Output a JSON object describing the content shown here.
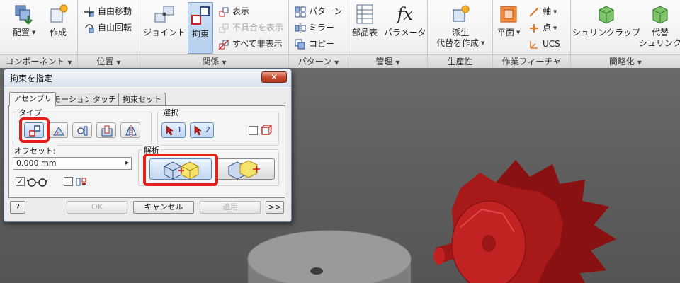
{
  "ribbon": {
    "component": {
      "title": "コンポーネント",
      "place_label": "配置",
      "create_label": "作成"
    },
    "position": {
      "title": "位置",
      "free_move_label": "自由移動",
      "free_rotate_label": "自由回転"
    },
    "relationships": {
      "title": "関係",
      "joint_label": "ジョイント",
      "constrain_label": "拘束",
      "show_label": "表示",
      "show_sick_label": "不具合を表示",
      "hide_all_label": "すべて非表示"
    },
    "pattern": {
      "title": "パターン",
      "pattern_label": "パターン",
      "mirror_label": "ミラー",
      "copy_label": "コピー"
    },
    "manage": {
      "title": "管理",
      "bom_label": "部品表",
      "parameters_label": "パラメータ",
      "fx_glyph": "fx"
    },
    "productivity": {
      "title": "生産性",
      "derive_label_1": "派生",
      "derive_label_2": "代替を作成"
    },
    "work_features": {
      "title": "作業フィーチャ",
      "plane_label": "平面",
      "axis_label": "軸",
      "point_label": "点",
      "ucs_label": "UCS"
    },
    "simplification": {
      "title": "簡略化",
      "shrinkwrap_label": "シュリンクラップ",
      "substitute_label_1": "代替",
      "substitute_label_2": "シュリンク"
    }
  },
  "dialog": {
    "title": "拘束を指定",
    "close_label": "✕",
    "tabs": [
      {
        "label": "アセンブリ",
        "active": true
      },
      {
        "label": "モーション",
        "active": false
      },
      {
        "label": "タッチ",
        "active": false
      },
      {
        "label": "拘束セット",
        "active": false
      }
    ],
    "type_group_label": "タイプ",
    "selection_group_label": "選択",
    "select1_label": "1",
    "select2_label": "2",
    "offset_label": "オフセット:",
    "offset_value": "0.000 mm",
    "preview_checked": true,
    "predict_checked": false,
    "analysis_group_label": "解析",
    "help_icon": "?",
    "ok_label": "OK",
    "cancel_label": "キャンセル",
    "apply_label": "適用",
    "expand_label": ">>"
  },
  "colors": {
    "highlight": "#e0211c",
    "gear": "#b01a1a",
    "disk": "#9a9a9a"
  }
}
